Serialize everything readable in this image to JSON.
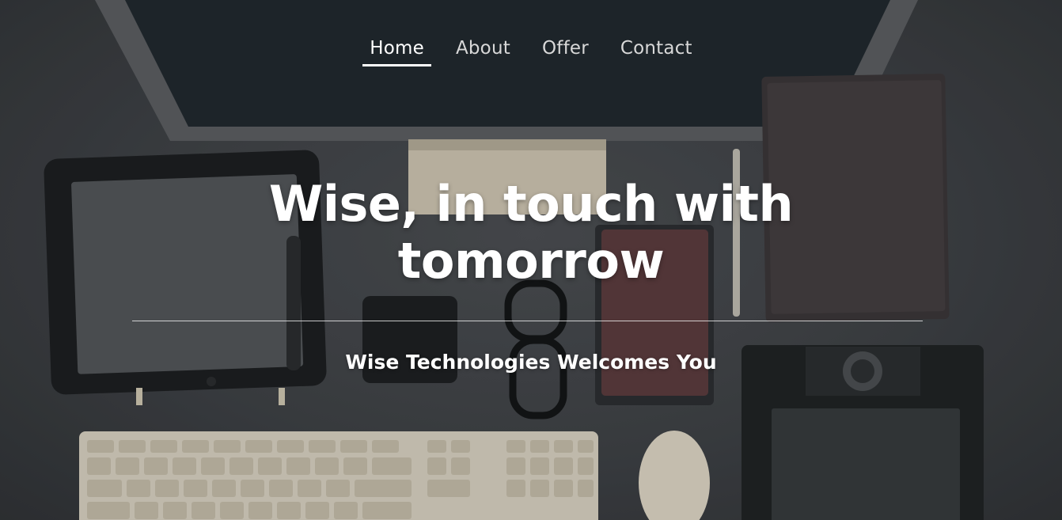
{
  "nav": {
    "items": [
      {
        "label": "Home",
        "active": true
      },
      {
        "label": "About",
        "active": false
      },
      {
        "label": "Offer",
        "active": false
      },
      {
        "label": "Contact",
        "active": false
      }
    ]
  },
  "hero": {
    "headline_line1": "Wise, in touch with",
    "headline_line2": "tomorrow",
    "subtitle": "Wise Technologies Welcomes You"
  },
  "background": {
    "description_icons": [
      "monitor",
      "tablet",
      "phone",
      "glasses",
      "notebook",
      "pen",
      "keyboard",
      "mouse",
      "graphics-tablet",
      "book"
    ]
  },
  "colors": {
    "text": "#ffffff",
    "nav_inactive": "#d8d8d8",
    "desk": "#3d3f43"
  }
}
